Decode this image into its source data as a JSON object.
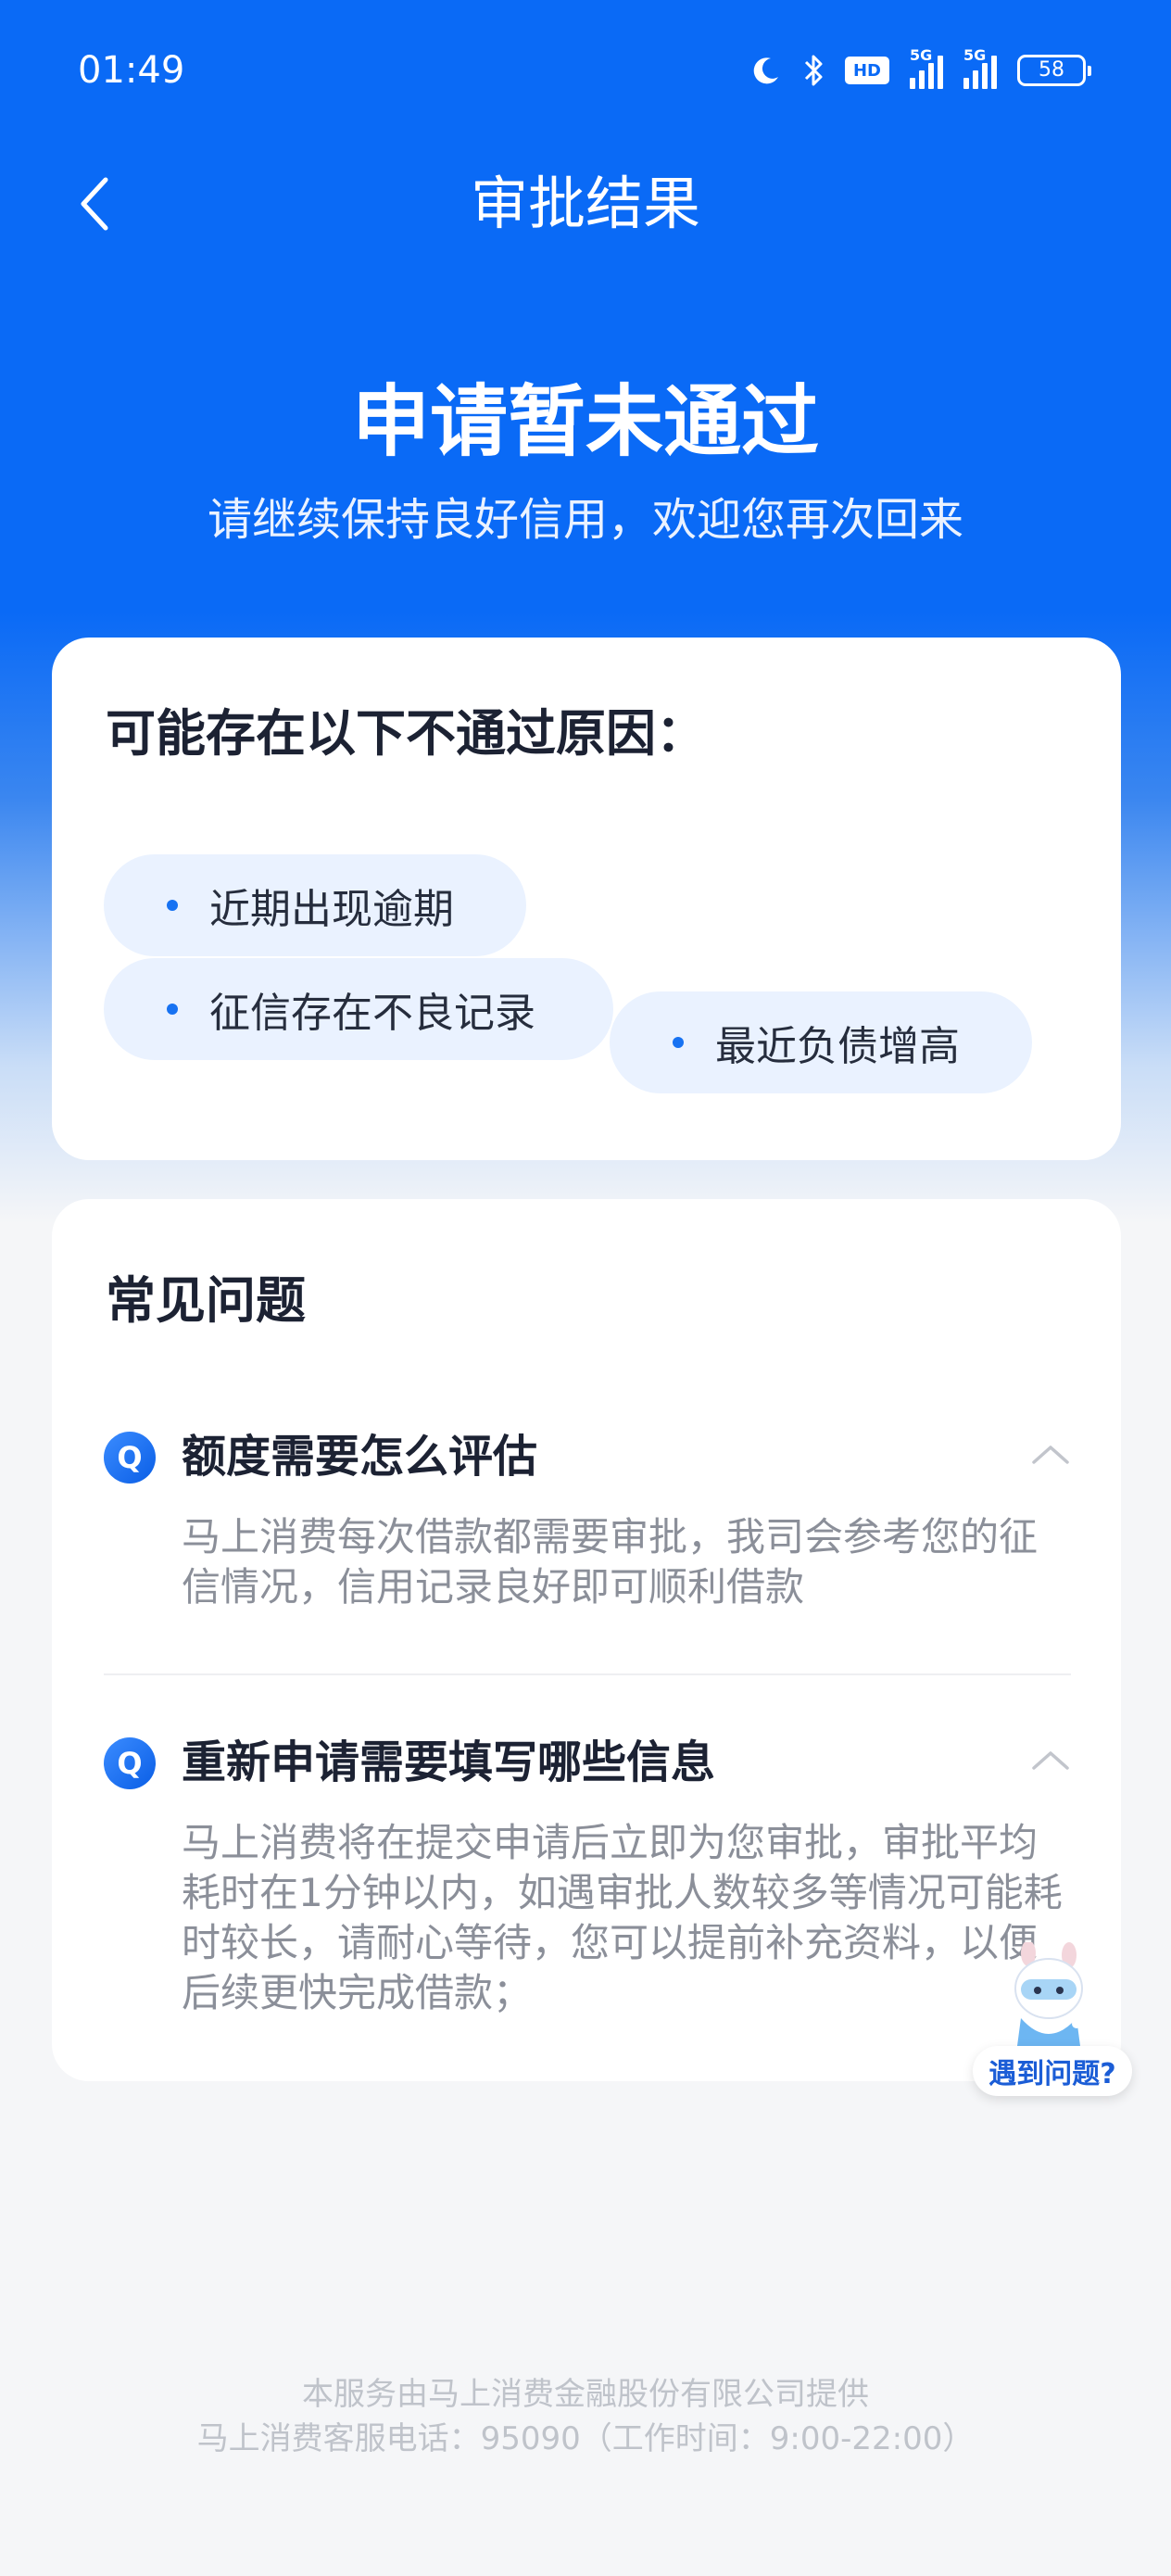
{
  "status_bar": {
    "time": "01:49",
    "hd_label": "HD",
    "signal_1_label": "5G",
    "signal_2_label": "5G",
    "battery_level": "58",
    "icons": [
      "moon-icon",
      "bluetooth-icon",
      "hd-icon",
      "signal-icon",
      "signal-icon",
      "battery-icon"
    ]
  },
  "nav": {
    "title": "审批结果",
    "back_icon": "chevron-left-icon"
  },
  "result": {
    "title": "申请暂未通过",
    "subtitle": "请继续保持良好信用，欢迎您再次回来"
  },
  "reasons": {
    "heading": "可能存在以下不通过原因：",
    "items": [
      {
        "label": "近期出现逾期"
      },
      {
        "label": "征信存在不良记录"
      },
      {
        "label": "最近负债增高"
      }
    ]
  },
  "faq": {
    "heading": "常见问题",
    "badge": "Q",
    "items": [
      {
        "question": "额度需要怎么评估",
        "answer": "马上消费每次借款都需要审批，我司会参考您的征信情况，信用记录良好即可顺利借款",
        "expanded": true
      },
      {
        "question": "重新申请需要填写哪些信息",
        "answer": "马上消费将在提交申请后立即为您审批，审批平均耗时在1分钟以内，如遇审批人数较多等情况可能耗时较长，请耐心等待，您可以提前补充资料，以便后续更快完成借款；",
        "expanded": true
      }
    ]
  },
  "help_widget": {
    "label": "遇到问题?"
  },
  "footer": {
    "line1": "本服务由马上消费金融股份有限公司提供",
    "line2": "马上消费客服电话：95090（工作时间：9:00-22:00）"
  },
  "colors": {
    "primary": "#0a6af6",
    "tag_bg": "#eaf2ff",
    "text_dark": "#1c2233",
    "text_muted": "#8b8f99"
  }
}
